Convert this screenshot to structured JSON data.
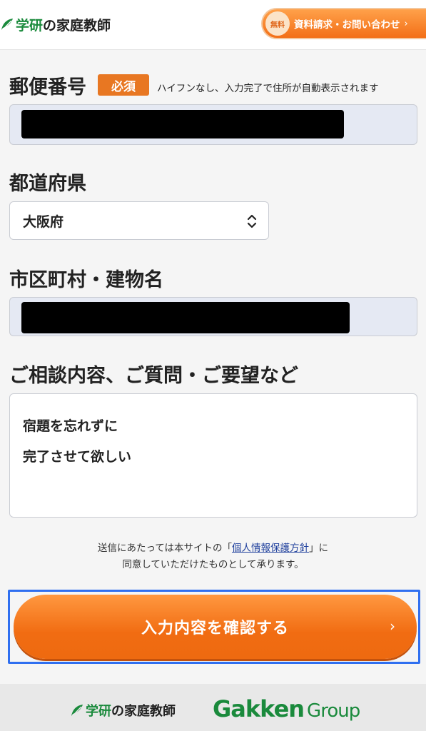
{
  "header": {
    "logo_main": "学研",
    "logo_rest": "の家庭教師",
    "free_badge": "無料",
    "cta_label": "資料請求・お問い合わせ",
    "cta_chevron": "›"
  },
  "form": {
    "postal": {
      "label": "郵便番号",
      "required": "必須",
      "hint": "ハイフンなし、入力完了で住所が自動表示されます"
    },
    "prefecture": {
      "label": "都道府県",
      "value": "大阪府"
    },
    "city": {
      "label": "市区町村・建物名"
    },
    "inquiry": {
      "label": "ご相談内容、ご質問・ご要望など",
      "lines": [
        "宿題を忘れずに",
        "完了させて欲しい"
      ]
    }
  },
  "consent": {
    "line1_before": "送信にあたっては本サイトの「",
    "link": "個人情報保護方針",
    "line1_after": "」に",
    "line2": "同意していただけたものとして承ります。"
  },
  "submit": {
    "label": "入力内容を確認する",
    "chevron": "›"
  },
  "footer": {
    "logo_main": "学研",
    "logo_rest": "の家庭教師",
    "brand": "Gakken",
    "brand_suffix": "Group"
  },
  "colors": {
    "accent_orange": "#f36f17",
    "brand_green": "#1a8a3c",
    "focus_blue": "#2f6ff0"
  }
}
